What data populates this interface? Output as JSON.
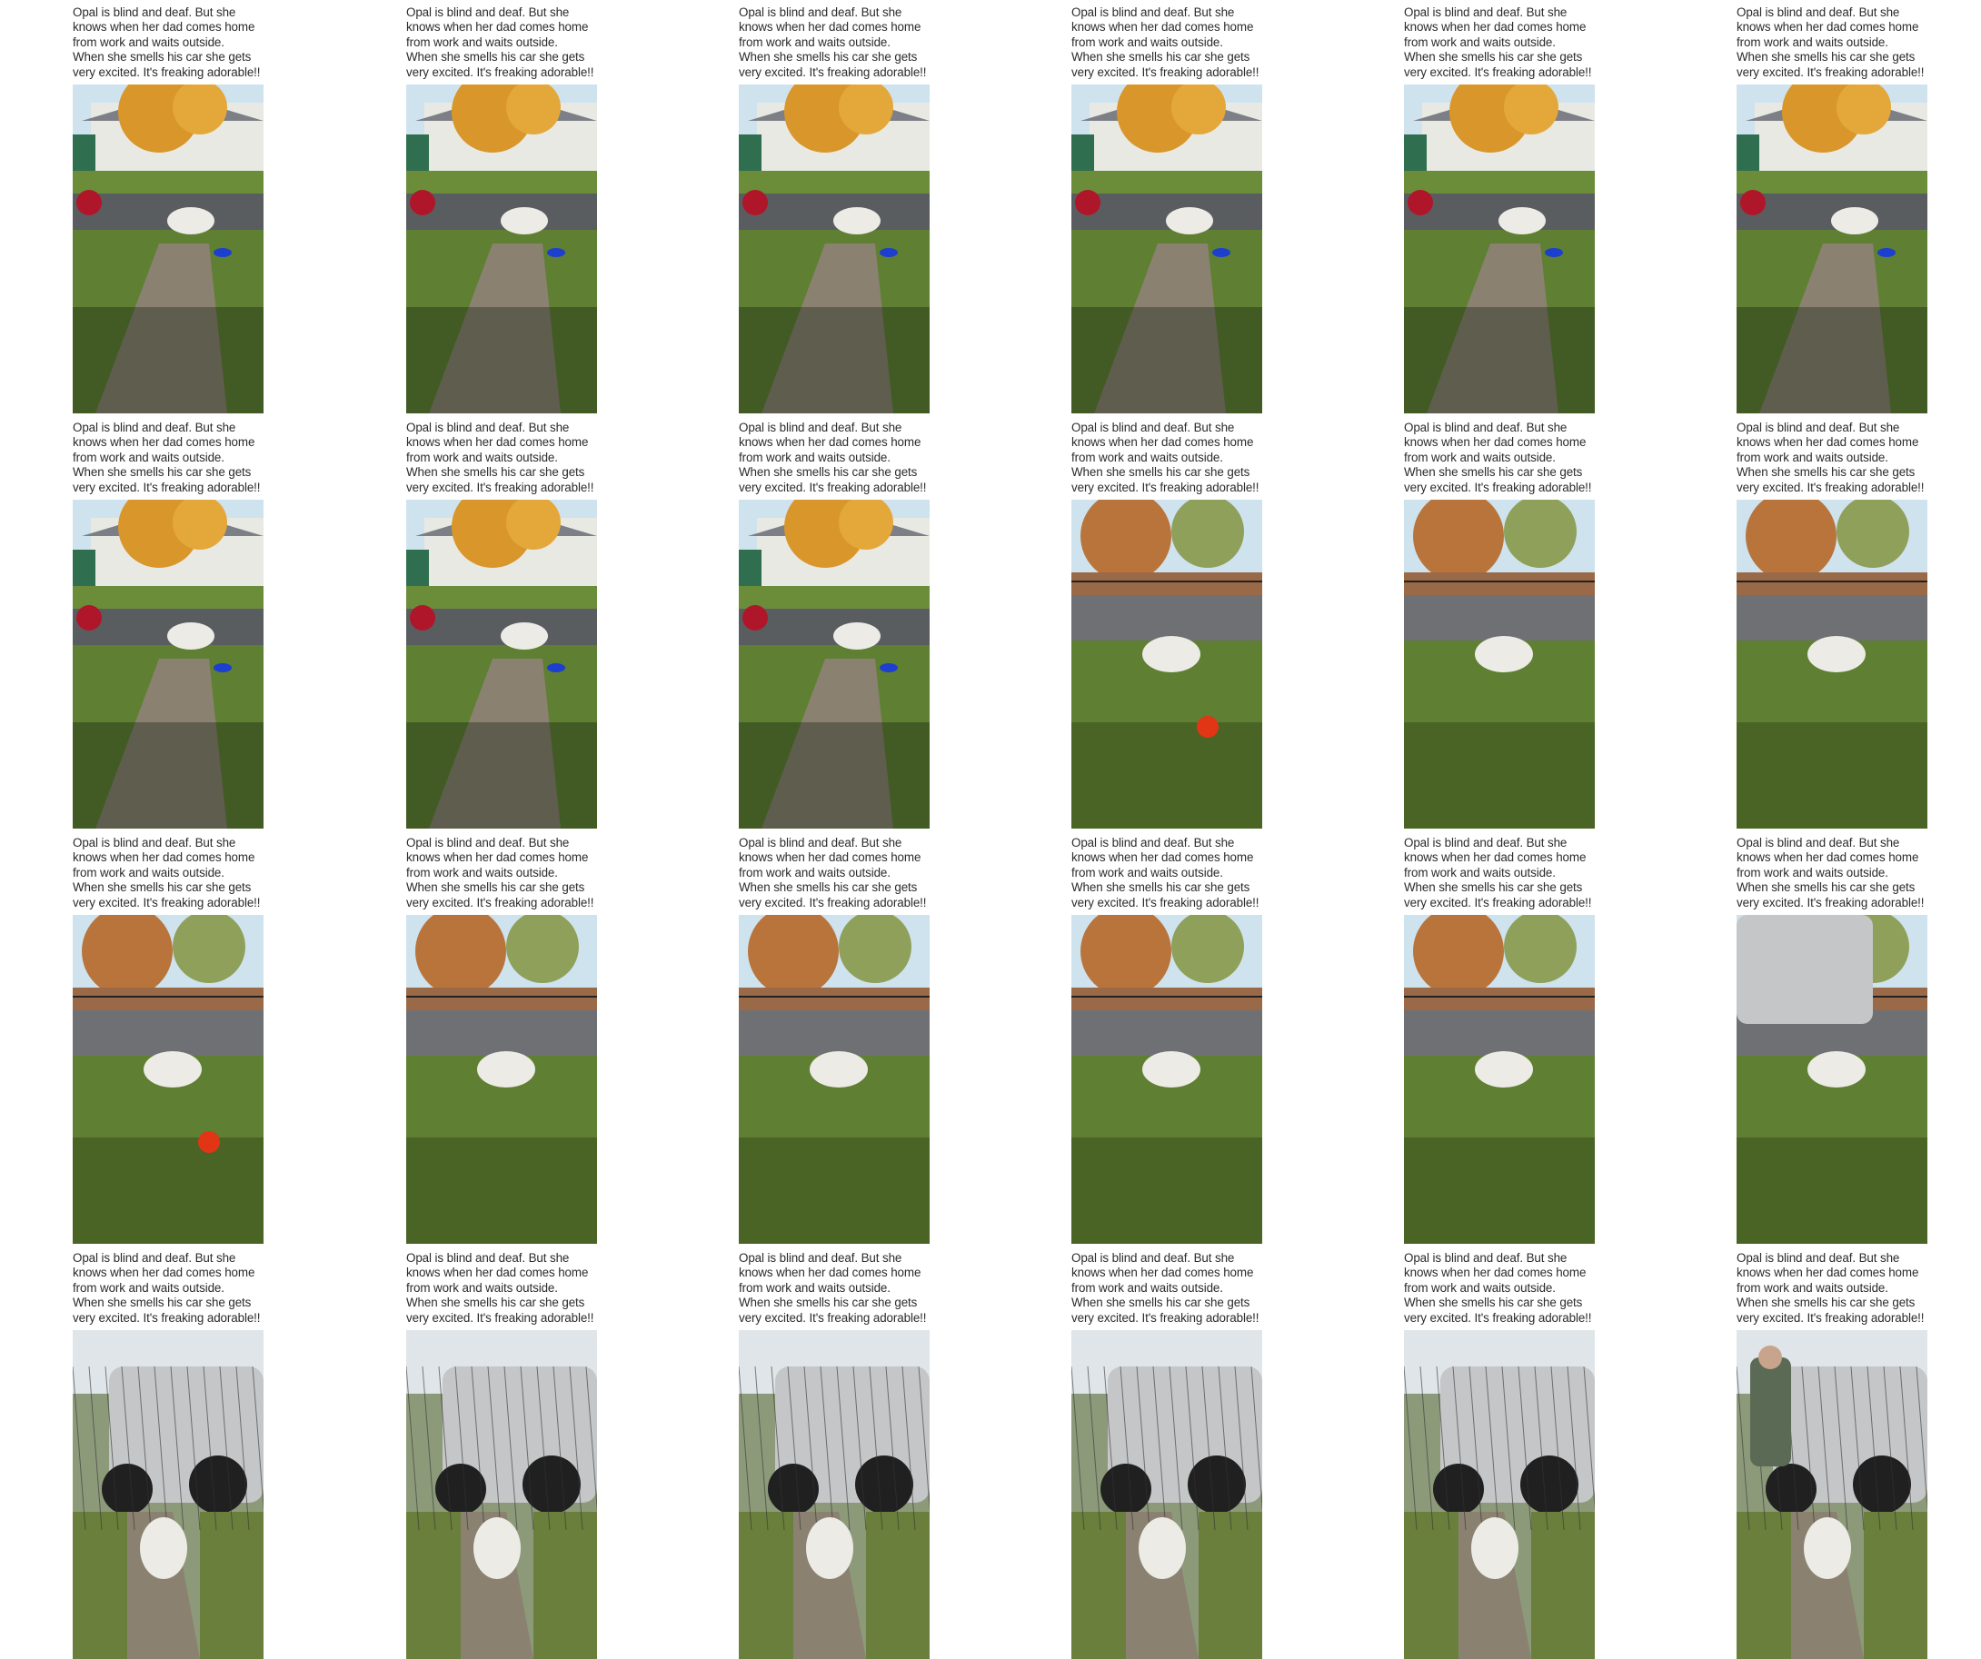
{
  "caption": "Opal is blind and deaf. But she\nknows when her dad comes home\nfrom work and waits outside.\nWhen she smells his car she gets\nvery excited. It's freaking adorable!!",
  "scenes": [
    "yard-dog-sidewalk-blue-bowl",
    "yard-dog-sidewalk-blue-bowl",
    "yard-dog-sidewalk-blue-bowl",
    "yard-dog-sidewalk-blue-bowl",
    "yard-dog-sidewalk-blue-bowl",
    "yard-dog-sidewalk-blue-bowl",
    "yard-dog-sidewalk-blue-bowl",
    "yard-dog-sidewalk-blue-bowl",
    "yard-dog-turning",
    "yard-dog-red-ball",
    "yard-dog-by-fence",
    "yard-dog-leaving-frame",
    "yard-dog-red-ball-far",
    "yard-dog-near-fence",
    "yard-dog-near-fence",
    "yard-dog-near-fence",
    "yard-dog-near-fence",
    "yard-dog-by-car",
    "gate-dog-car",
    "gate-dog-jumping",
    "gate-dog-jumping",
    "gate-dog-jumping",
    "gate-dog-waiting",
    "gate-man-and-dog"
  ],
  "colors": {
    "grass": "#5f7f32",
    "path": "#8a8170",
    "sky": "#cfe3ef",
    "tree": "#d9962a",
    "dog": "#ecebe6",
    "ball": "#e23515",
    "bowl": "#1c3fd0",
    "car": "#c4c6c8"
  }
}
